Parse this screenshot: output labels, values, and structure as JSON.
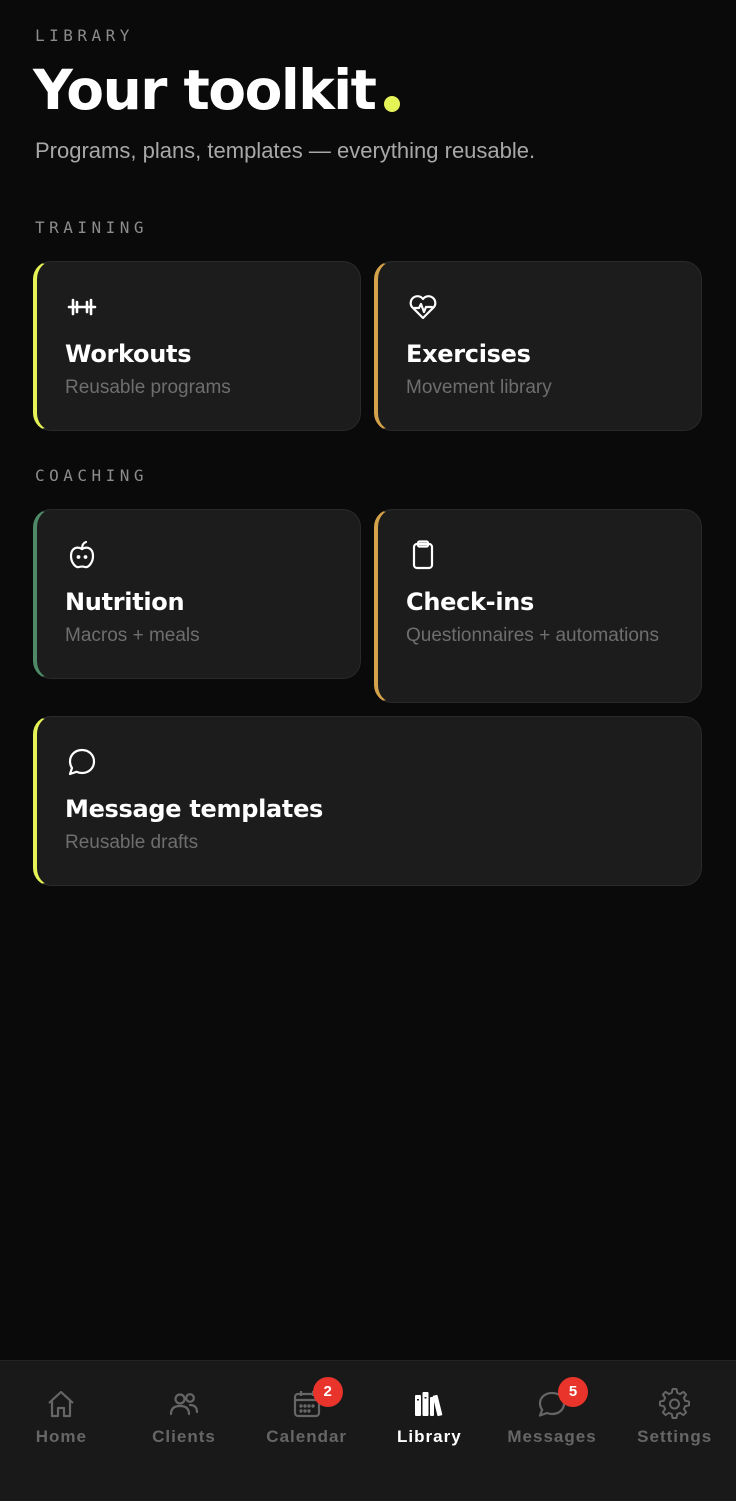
{
  "header": {
    "eyebrow": "LIBRARY",
    "title": "Your toolkit",
    "subtitle": "Programs, plans, templates — everything reusable.",
    "accent_color": "#e5f356"
  },
  "sections": {
    "training_label": "TRAINING",
    "coaching_label": "COACHING"
  },
  "cards": {
    "workouts": {
      "title": "Workouts",
      "subtitle": "Reusable programs",
      "icon": "dumbbell-icon",
      "accent": "#e5f356"
    },
    "exercises": {
      "title": "Exercises",
      "subtitle": "Movement library",
      "icon": "heartbeat-icon",
      "accent": "#d4a24a"
    },
    "nutrition": {
      "title": "Nutrition",
      "subtitle": "Macros + meals",
      "icon": "apple-icon",
      "accent": "#4e8a67"
    },
    "checkins": {
      "title": "Check-ins",
      "subtitle": "Questionnaires + automations",
      "icon": "clipboard-icon",
      "accent": "#d4a24a"
    },
    "message_templates": {
      "title": "Message templates",
      "subtitle": "Reusable drafts",
      "icon": "chat-bubble-icon",
      "accent": "#e5f356"
    }
  },
  "tabbar": {
    "items": [
      {
        "label": "Home",
        "icon": "home-icon",
        "active": false
      },
      {
        "label": "Clients",
        "icon": "users-icon",
        "active": false
      },
      {
        "label": "Calendar",
        "icon": "calendar-icon",
        "active": false,
        "badge": "2"
      },
      {
        "label": "Library",
        "icon": "library-icon",
        "active": true
      },
      {
        "label": "Messages",
        "icon": "message-icon",
        "active": false,
        "badge": "5"
      },
      {
        "label": "Settings",
        "icon": "gear-icon",
        "active": false
      }
    ],
    "badge_color": "#e8342a"
  }
}
